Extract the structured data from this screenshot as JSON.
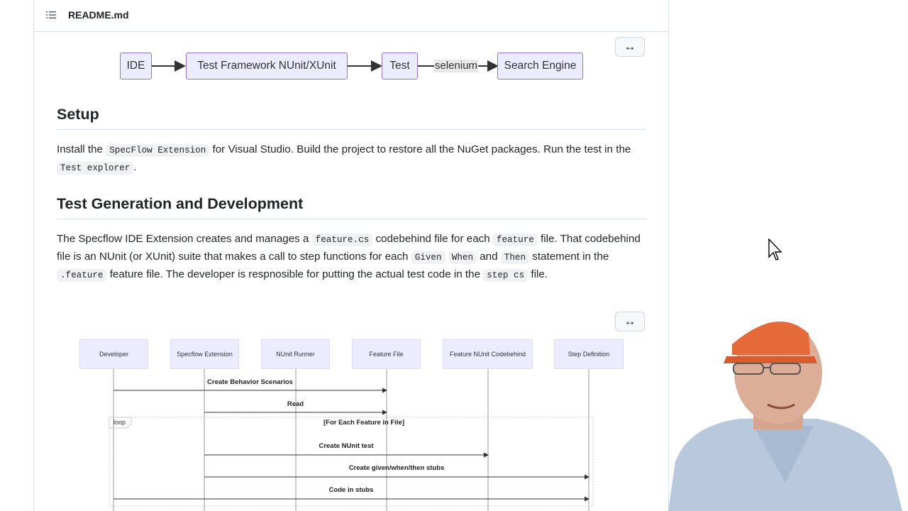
{
  "file_header": {
    "filename": "README.md",
    "toc_icon": "list-unordered-icon"
  },
  "flowchart": {
    "nodes": [
      "IDE",
      "Test Framework NUnit/XUnit",
      "Test",
      "Search Engine"
    ],
    "edge_label": "selenium",
    "expand_icon": "arrows-horizontal-icon"
  },
  "setup": {
    "heading": "Setup",
    "t1": "Install the ",
    "c1": "SpecFlow Extension",
    "t2": " for Visual Studio. Build the project to restore all the NuGet packages. Run the test in the ",
    "c2": "Test explorer",
    "t3": "."
  },
  "testgen": {
    "heading": "Test Generation and Development",
    "t1": "The Specflow IDE Extension creates and manages a ",
    "c1": "feature.cs",
    "t2": " codebehind file for each ",
    "c2": "feature",
    "t3": " file. That codebehind file is an NUnit (or XUnit) suite that makes a call to step functions for each ",
    "c3": "Given",
    "t4": " ",
    "c4": "When",
    "t5": " and ",
    "c5": "Then",
    "t6": " statement in the ",
    "c6": ".feature",
    "t7": " feature file. The developer is respnosible for putting the actual test code in the ",
    "c7": "step cs",
    "t8": " file."
  },
  "sequence": {
    "actors": [
      "Developer",
      "Specflow Extension",
      "NUnit Runner",
      "Feature File",
      "Feature NUnit Codebehind",
      "Step Definition"
    ],
    "messages": [
      "Create Behavior Scenarios",
      "Read",
      "Create NUnit test",
      "Create given/when/then stubs",
      "Code in stubs"
    ],
    "loop_label": "loop",
    "loop_condition": "[For Each Feature in File]"
  },
  "colors": {
    "node_fill": "#ececff",
    "node_border": "#9370db",
    "accent_text": "#1f2328"
  }
}
